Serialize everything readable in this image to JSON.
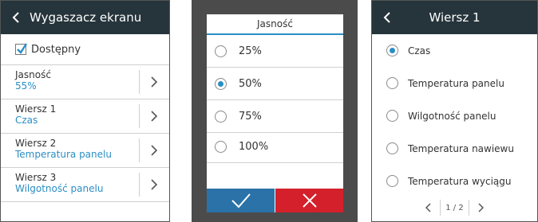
{
  "screen_saver": {
    "title": "Wygaszacz ekranu",
    "available_label": "Dostępny",
    "available_checked": true,
    "items": [
      {
        "label": "Jasność",
        "value": "55%"
      },
      {
        "label": "Wiersz 1",
        "value": "Czas"
      },
      {
        "label": "Wiersz 2",
        "value": "Temperatura panelu"
      },
      {
        "label": "Wiersz 3",
        "value": "Wilgotność panelu"
      }
    ]
  },
  "brightness_dialog": {
    "title": "Jasność",
    "options": [
      "25%",
      "50%",
      "75%",
      "100%"
    ],
    "selected": "50%"
  },
  "row1": {
    "title": "Wiersz 1",
    "options": [
      "Czas",
      "Temperatura panelu",
      "Wilgotność panelu",
      "Temperatura nawiewu",
      "Temperatura wyciągu"
    ],
    "selected": "Czas",
    "pager": {
      "text": "1 / 2"
    }
  },
  "colors": {
    "header": "#26343b",
    "accent": "#2a8ec4",
    "ok": "#2a72a8",
    "cancel": "#d3202a"
  }
}
